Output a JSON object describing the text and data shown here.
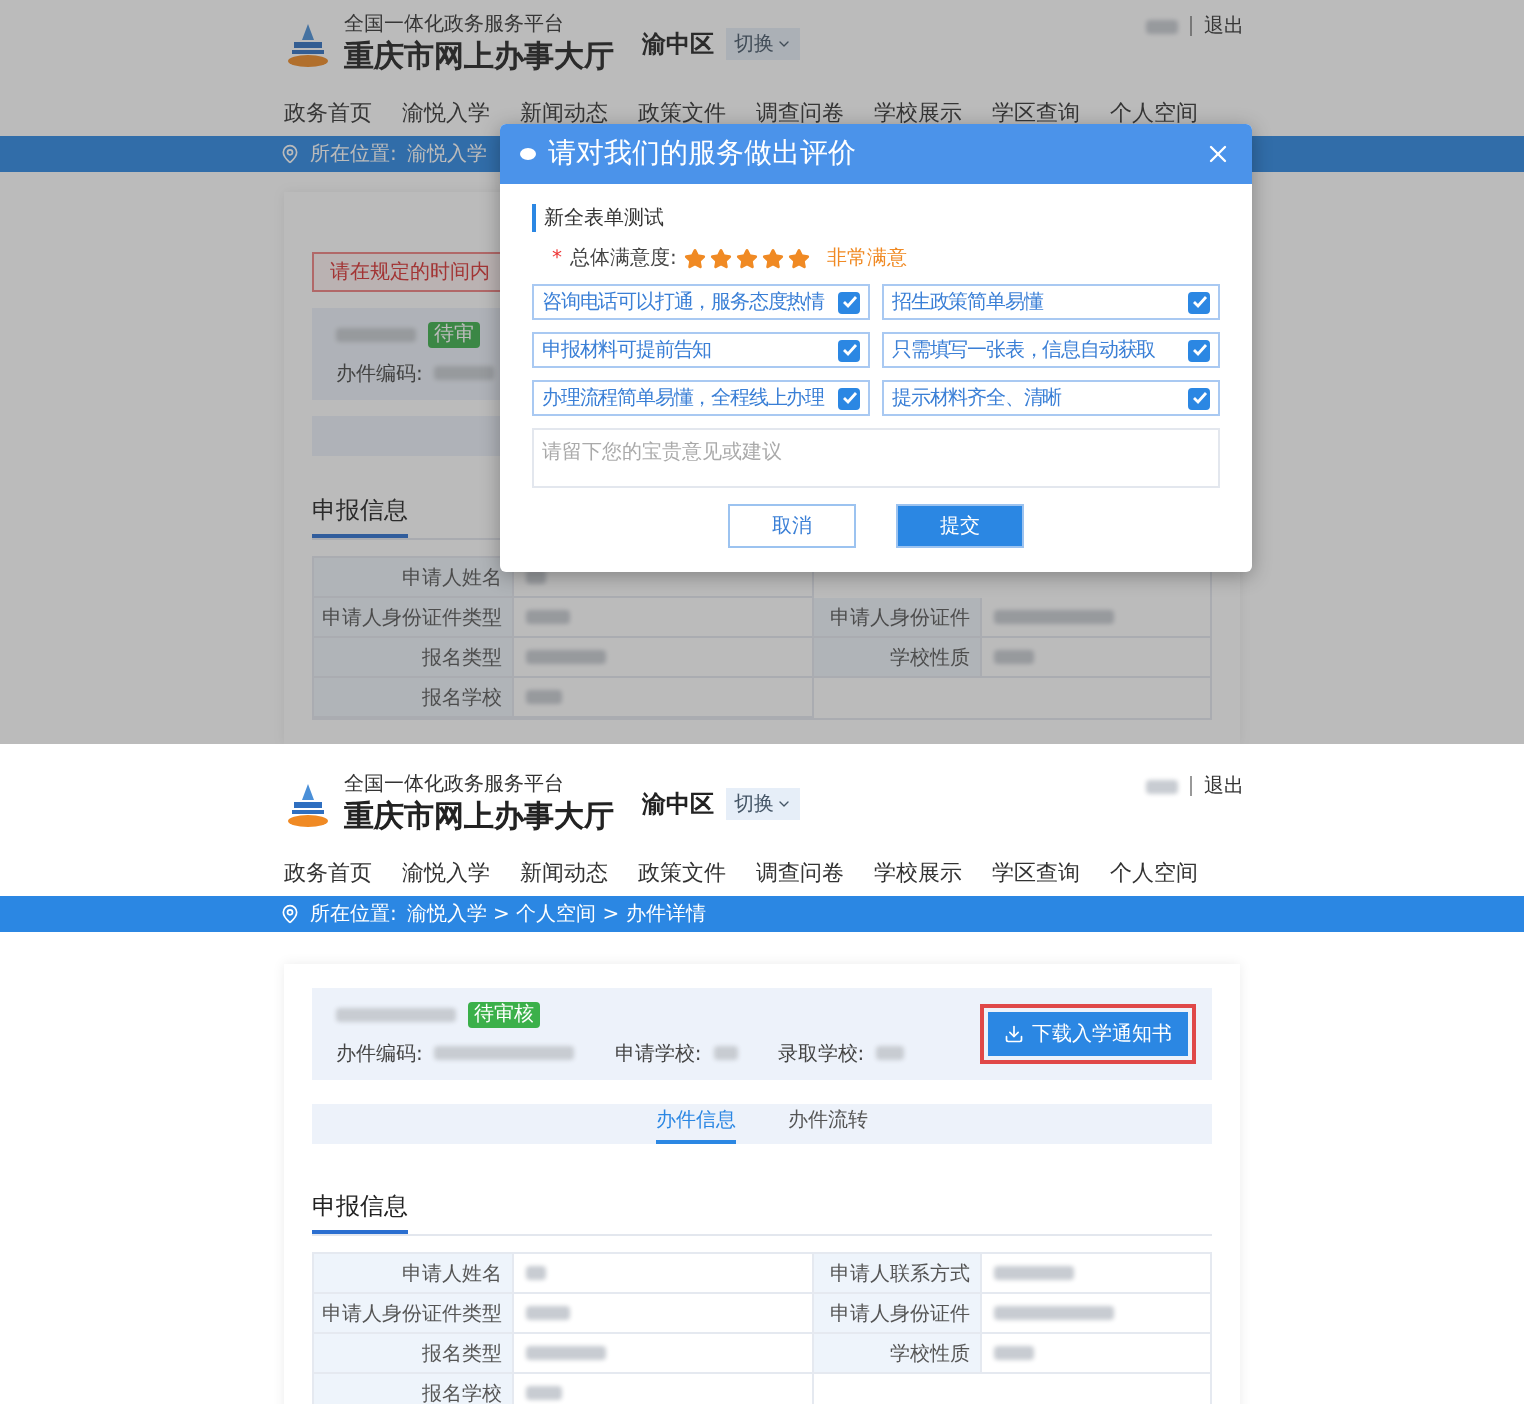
{
  "screens": [
    {
      "kind": "dialog_open",
      "header": {
        "platform": "全国一体化政务服务平台",
        "site": "重庆市网上办事大厅",
        "district": "渝中区",
        "switch": "切换",
        "logout": "退出"
      },
      "nav": [
        "政务首页",
        "渝悦入学",
        "新闻动态",
        "政策文件",
        "调查问卷",
        "学校展示",
        "学区查询",
        "个人空间"
      ],
      "breadcrumb": {
        "label": "所在位置:",
        "path": "渝悦入学"
      },
      "warning": "请在规定的时间内",
      "card": {
        "badge": "待审",
        "code_label": "办件编码:"
      },
      "section_title": "申报信息",
      "rows": [
        {
          "left_label": "申请人姓名"
        },
        {
          "left_label": "申请人身份证件类型",
          "right_label": "申请人身份证件"
        },
        {
          "left_label": "报名类型",
          "right_label": "学校性质"
        },
        {
          "left_label": "报名学校"
        }
      ],
      "dialog": {
        "title": "请对我们的服务做出评价",
        "section": "新全表单测试",
        "rating": {
          "required_mark": "*",
          "label": "总体满意度:",
          "stars": 5,
          "verdict": "非常满意"
        },
        "options": [
          {
            "label": "咨询电话可以打通，服务态度热情",
            "checked": true
          },
          {
            "label": "招生政策简单易懂",
            "checked": true
          },
          {
            "label": "申报材料可提前告知",
            "checked": true
          },
          {
            "label": "只需填写一张表，信息自动获取",
            "checked": true
          },
          {
            "label": "办理流程简单易懂，全程线上办理",
            "checked": true
          },
          {
            "label": "提示材料齐全、清晰",
            "checked": true
          }
        ],
        "placeholder": "请留下您的宝贵意见或建议",
        "cancel": "取消",
        "submit": "提交"
      }
    },
    {
      "kind": "detail",
      "header": {
        "platform": "全国一体化政务服务平台",
        "site": "重庆市网上办事大厅",
        "district": "渝中区",
        "switch": "切换",
        "logout": "退出"
      },
      "nav": [
        "政务首页",
        "渝悦入学",
        "新闻动态",
        "政策文件",
        "调查问卷",
        "学校展示",
        "学区查询",
        "个人空间"
      ],
      "breadcrumb": {
        "label": "所在位置:",
        "path": "渝悦入学 > 个人空间 > 办件详情"
      },
      "card": {
        "badge": "待审核",
        "code_label": "办件编码:",
        "apply_label": "申请学校:",
        "admit_label": "录取学校:",
        "download": "下载入学通知书"
      },
      "tabs": [
        {
          "label": "办件信息",
          "selected": true
        },
        {
          "label": "办件流转",
          "selected": false
        }
      ],
      "section_title": "申报信息",
      "rows": [
        {
          "left_label": "申请人姓名",
          "right_label": "申请人联系方式"
        },
        {
          "left_label": "申请人身份证件类型",
          "right_label": "申请人身份证件"
        },
        {
          "left_label": "报名类型",
          "right_label": "学校性质"
        },
        {
          "left_label": "报名学校"
        }
      ]
    }
  ]
}
